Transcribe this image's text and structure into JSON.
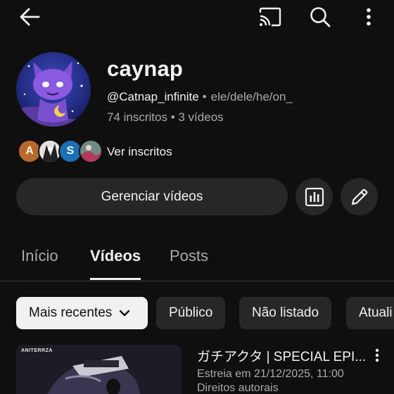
{
  "header": {
    "back_icon": "arrow-left-icon",
    "cast_icon": "cast-icon",
    "search_icon": "search-icon",
    "more_icon": "more-vertical-icon"
  },
  "channel": {
    "name": "caynap",
    "handle": "@Catnap_infinite",
    "separator": "•",
    "pronouns": "ele/dele/he/on_",
    "stats": "74 inscritos • 3 vídeos",
    "avatar_icon": "avatar-purple-cat"
  },
  "subscribers": {
    "avatars": [
      {
        "letter": "A",
        "color": "#b86a2e"
      },
      {
        "letter": "",
        "color": "#d8d8d8"
      },
      {
        "letter": "S",
        "color": "#1b6fb5"
      },
      {
        "letter": "",
        "color": "#8a3350"
      }
    ],
    "label": "Ver inscritos"
  },
  "actions": {
    "manage_label": "Gerenciar vídeos",
    "analytics_icon": "bar-chart-icon",
    "edit_icon": "pencil-icon"
  },
  "tabs": [
    {
      "label": "Início",
      "active": false
    },
    {
      "label": "Vídeos",
      "active": true
    },
    {
      "label": "Posts",
      "active": false
    }
  ],
  "filters": {
    "sort_label": "Mais recentes",
    "chips": [
      "Público",
      "Não listado",
      "Atuali"
    ]
  },
  "video": {
    "thumb_label": "ANITERRZA",
    "title": "ガチアクタ | SPECIAL EPI...",
    "premiere": "Estreia em 21/12/2025, 11:00",
    "rights": "Direitos autorais",
    "more_icon": "more-vertical-icon"
  },
  "colors": {
    "background": "#0f0f0f",
    "surface": "#272727",
    "text_primary": "#f1f1f1",
    "text_secondary": "#aaaaaa"
  }
}
